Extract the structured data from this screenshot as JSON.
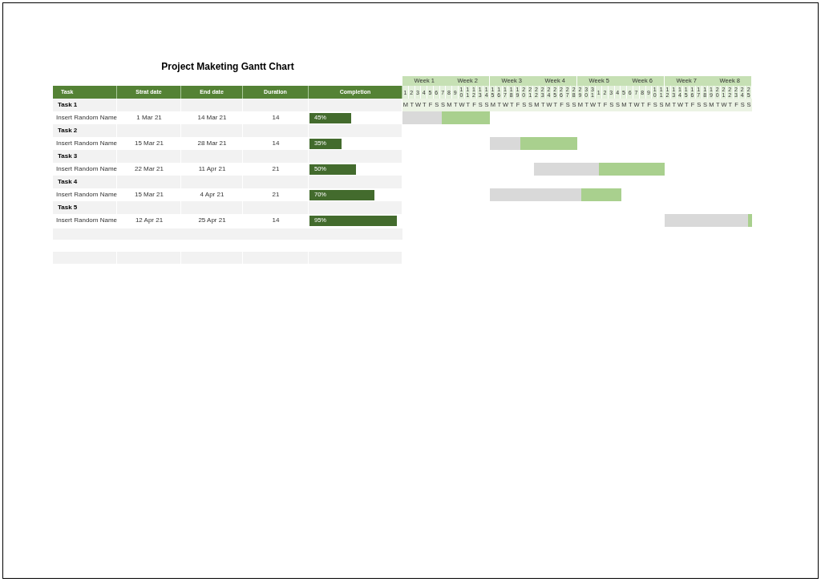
{
  "title": "Project Maketing Gantt Chart",
  "table": {
    "columns": [
      "Task",
      "Strat date",
      "End date",
      "Duration",
      "Completion"
    ],
    "rows": [
      {
        "kind": "group",
        "task": "Task 1"
      },
      {
        "kind": "item",
        "task": "Insert Random Name",
        "start": "1 Mar 21",
        "end": "14 Mar 21",
        "duration": "14",
        "completion": "45%",
        "level": 0.45
      },
      {
        "kind": "group",
        "task": "Task 2"
      },
      {
        "kind": "item",
        "task": "Insert Random Name",
        "start": "15 Mar 21",
        "end": "28 Mar 21",
        "duration": "14",
        "completion": "35%",
        "level": 0.35
      },
      {
        "kind": "group",
        "task": "Task 3"
      },
      {
        "kind": "item",
        "task": "Insert Random Name",
        "start": "22 Mar 21",
        "end": "11 Apr 21",
        "duration": "21",
        "completion": "50%",
        "level": 0.5
      },
      {
        "kind": "group",
        "task": "Task 4"
      },
      {
        "kind": "item",
        "task": "Insert Random Name",
        "start": "15 Mar 21",
        "end": "4 Apr 21",
        "duration": "21",
        "completion": "70%",
        "level": 0.7
      },
      {
        "kind": "group",
        "task": "Task 5"
      },
      {
        "kind": "item",
        "task": "Insert Random Name",
        "start": "12 Apr 21",
        "end": "25 Apr 21",
        "duration": "14",
        "completion": "95%",
        "level": 0.95
      }
    ]
  },
  "timeline": {
    "weeks": [
      "Week 1",
      "Week 2",
      "Week 3",
      "Week 4",
      "Week 5",
      "Week 6",
      "Week 7",
      "Week 8"
    ],
    "days": [
      "1",
      "2",
      "3",
      "4",
      "5",
      "6",
      "7",
      "8",
      "9",
      "10",
      "11",
      "12",
      "13",
      "14",
      "15",
      "16",
      "17",
      "18",
      "19",
      "20",
      "21",
      "22",
      "23",
      "24",
      "25",
      "26",
      "27",
      "28",
      "29",
      "30",
      "31",
      "1",
      "2",
      "3",
      "4",
      "5",
      "6",
      "7",
      "8",
      "9",
      "10",
      "11",
      "12",
      "13",
      "14",
      "15",
      "16",
      "17",
      "18",
      "19",
      "20",
      "21",
      "22",
      "23",
      "24",
      "25"
    ],
    "weekdays": [
      "M",
      "T",
      "W",
      "T",
      "F",
      "S",
      "S",
      "M",
      "T",
      "W",
      "T",
      "F",
      "S",
      "S",
      "M",
      "T",
      "W",
      "T",
      "F",
      "S",
      "S",
      "M",
      "T",
      "W",
      "T",
      "F",
      "S",
      "S",
      "M",
      "T",
      "W",
      "T",
      "F",
      "S",
      "S",
      "M",
      "T",
      "W",
      "T",
      "F",
      "S",
      "S",
      "M",
      "T",
      "W",
      "T",
      "F",
      "S",
      "S",
      "M",
      "T",
      "W",
      "T",
      "F",
      "S",
      "S"
    ]
  }
}
